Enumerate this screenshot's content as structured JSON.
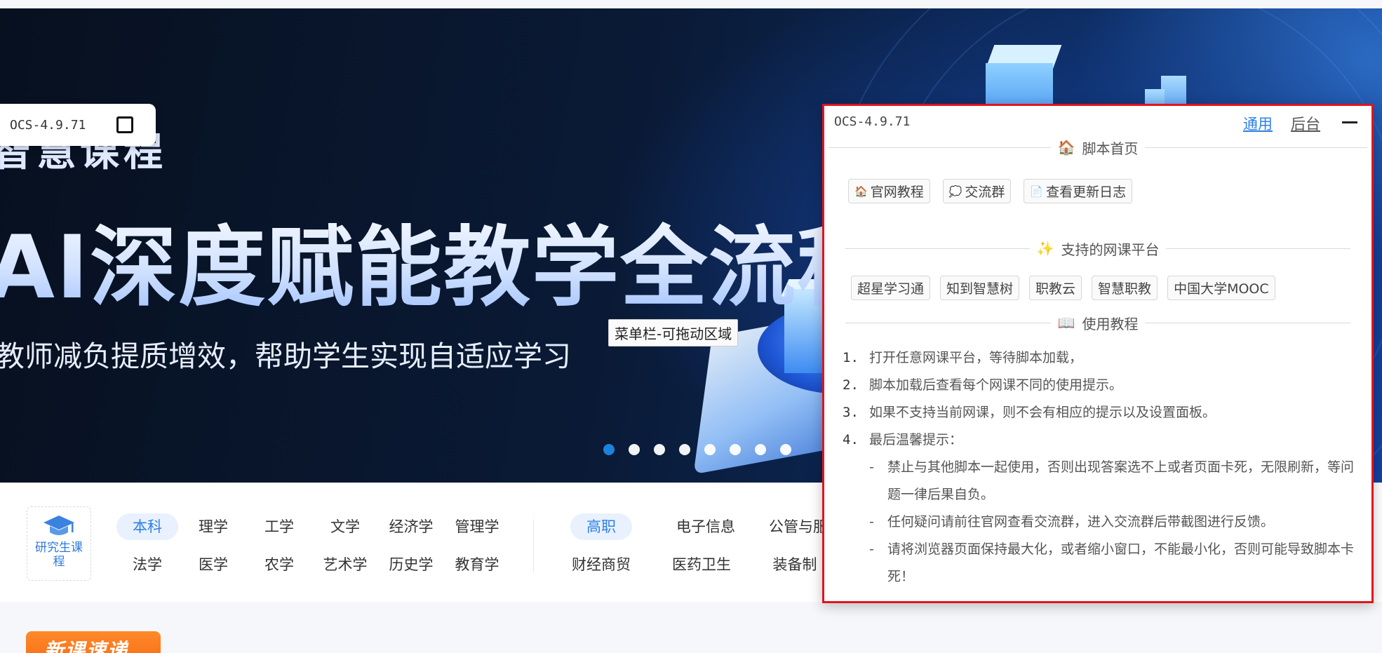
{
  "banner": {
    "subtitle": "智慧课程",
    "title": "AI深度赋能教学全流程",
    "description": "教师减负提质增效，帮助学生实现自适应学习",
    "slide_count": 8,
    "active_slide_index": 0
  },
  "drag_tooltip": "菜单栏-可拖动区域",
  "mini_widget": {
    "title": "OCS-4.9.71"
  },
  "category_nav": {
    "graduate_label": "研究生课程",
    "undergrad_group": "本科",
    "undergrad_items": [
      "理学",
      "工学",
      "文学",
      "经济学",
      "管理学",
      "法学",
      "医学",
      "农学",
      "艺术学",
      "历史学",
      "教育学"
    ],
    "vocational_group": "高职",
    "vocational_items": [
      "电子信息",
      "公管与服",
      "财经商贸",
      "医药卫生",
      "装备制"
    ]
  },
  "new_course_badge": "新课速递",
  "panel": {
    "title": "OCS-4.9.71",
    "tabs": [
      {
        "label": "通用",
        "active": true
      },
      {
        "label": "后台",
        "active": false
      }
    ],
    "home_section": {
      "title": "脚本首页",
      "icon": "house-icon",
      "buttons": [
        {
          "label": "官网教程",
          "icon": "house-icon"
        },
        {
          "label": "交流群",
          "icon": "chat-bubble-icon"
        },
        {
          "label": "查看更新日志",
          "icon": "document-icon"
        }
      ]
    },
    "platforms_section": {
      "title": "支持的网课平台",
      "icon": "sparkles-icon",
      "platforms": [
        "超星学习通",
        "知到智慧树",
        "职教云",
        "智慧职教",
        "中国大学MOOC"
      ]
    },
    "tutorial_section": {
      "title": "使用教程",
      "icon": "book-icon",
      "steps": [
        {
          "num": "1.",
          "text": "打开任意网课平台，等待脚本加载，"
        },
        {
          "num": "2.",
          "text": "脚本加载后查看每个网课不同的使用提示。"
        },
        {
          "num": "3.",
          "text": "如果不支持当前网课，则不会有相应的提示以及设置面板。"
        },
        {
          "num": "4.",
          "text": "最后温馨提示："
        }
      ],
      "tips": [
        "禁止与其他脚本一起使用，否则出现答案选不上或者页面卡死，无限刷新，等问题一律后果自负。",
        "任何疑问请前往官网查看交流群，进入交流群后带截图进行反馈。",
        "请将浏览器页面保持最大化，或者缩小窗口，不能最小化，否则可能导致脚本卡死！"
      ]
    }
  },
  "colors": {
    "accent_blue": "#2f80e6",
    "panel_border_red": "#e2141d",
    "badge_orange": "#f76a12",
    "active_dot_blue": "#1e88e5"
  }
}
